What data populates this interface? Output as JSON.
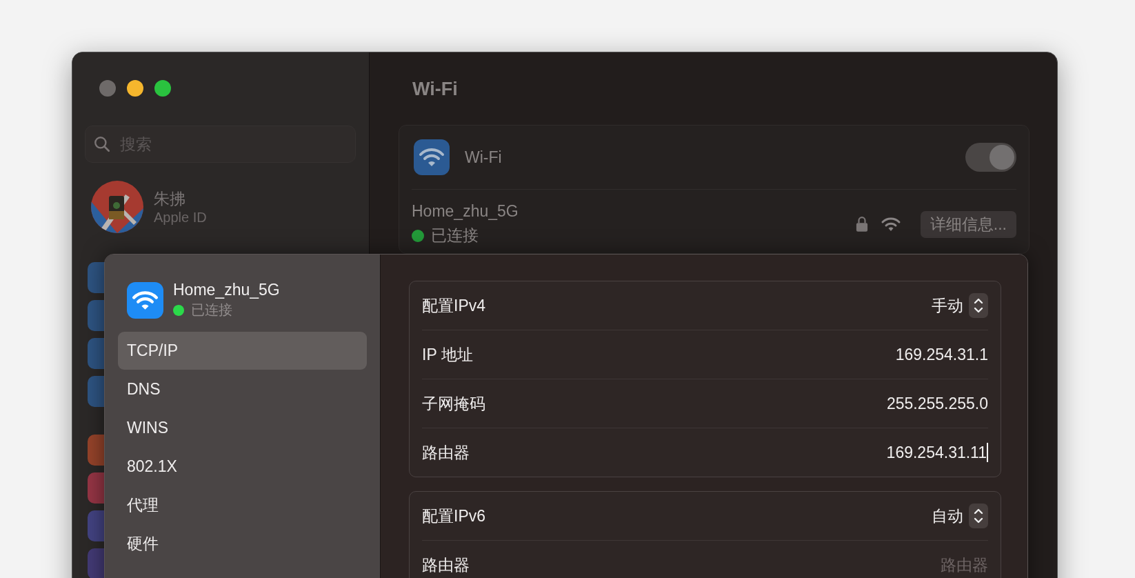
{
  "sidebar": {
    "search": {
      "placeholder": "搜索"
    },
    "account": {
      "name": "朱拂",
      "subtitle": "Apple ID"
    }
  },
  "main": {
    "title": "Wi-Fi",
    "wifi": {
      "label": "Wi-Fi",
      "on": true
    },
    "network": {
      "name": "Home_zhu_5G",
      "status": "已连接",
      "details_button": "详细信息..."
    }
  },
  "sheet": {
    "network": {
      "name": "Home_zhu_5G",
      "status": "已连接"
    },
    "tabs": [
      {
        "label": "TCP/IP",
        "selected": true
      },
      {
        "label": "DNS",
        "selected": false
      },
      {
        "label": "WINS",
        "selected": false
      },
      {
        "label": "802.1X",
        "selected": false
      },
      {
        "label": "代理",
        "selected": false
      },
      {
        "label": "硬件",
        "selected": false
      }
    ],
    "groups": [
      {
        "rows": [
          {
            "kind": "popup",
            "label": "配置IPv4",
            "value": "手动"
          },
          {
            "kind": "field",
            "label": "IP 地址",
            "value": "169.254.31.1",
            "focused": false
          },
          {
            "kind": "field",
            "label": "子网掩码",
            "value": "255.255.255.0",
            "focused": false
          },
          {
            "kind": "field",
            "label": "路由器",
            "value": "169.254.31.11",
            "focused": true
          }
        ]
      },
      {
        "rows": [
          {
            "kind": "popup",
            "label": "配置IPv6",
            "value": "自动"
          },
          {
            "kind": "field",
            "label": "路由器",
            "placeholder": "路由器",
            "focused": false
          }
        ]
      }
    ]
  }
}
